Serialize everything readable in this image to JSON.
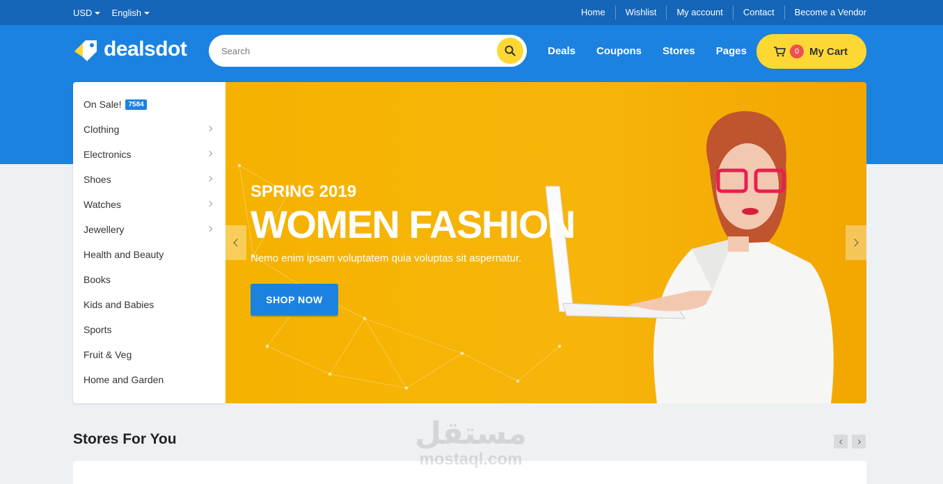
{
  "topbar": {
    "currency": "USD",
    "language": "English",
    "links": [
      "Home",
      "Wishlist",
      "My account",
      "Contact",
      "Become a Vendor"
    ]
  },
  "header": {
    "logo_text": "dealsdot",
    "search_placeholder": "Search",
    "nav": [
      "Deals",
      "Coupons",
      "Stores",
      "Pages"
    ],
    "cart": {
      "count": "0",
      "label": "My Cart"
    }
  },
  "sidebar": {
    "items": [
      {
        "label": "On Sale!",
        "badge": "7584"
      },
      {
        "label": "Clothing",
        "has_submenu": true
      },
      {
        "label": "Electronics",
        "has_submenu": true
      },
      {
        "label": "Shoes",
        "has_submenu": true
      },
      {
        "label": "Watches",
        "has_submenu": true
      },
      {
        "label": "Jewellery",
        "has_submenu": true
      },
      {
        "label": "Health and Beauty"
      },
      {
        "label": "Books"
      },
      {
        "label": "Kids and Babies"
      },
      {
        "label": "Sports"
      },
      {
        "label": "Fruit & Veg"
      },
      {
        "label": "Home and Garden"
      }
    ]
  },
  "banner": {
    "subtitle": "SPRING 2019",
    "title": "WOMEN FASHION",
    "description": "Nemo enim ipsam voluptatem quia voluptas sit aspernatur.",
    "button": "SHOP NOW"
  },
  "stores": {
    "title": "Stores For You"
  },
  "watermark": {
    "arabic": "مستقل",
    "latin": "mostaql.com"
  },
  "colors": {
    "topbar": "#1565b8",
    "header": "#1b83df",
    "accent_yellow": "#fdd835",
    "banner": "#f5b200",
    "cart_badge": "#ef4f4f"
  }
}
